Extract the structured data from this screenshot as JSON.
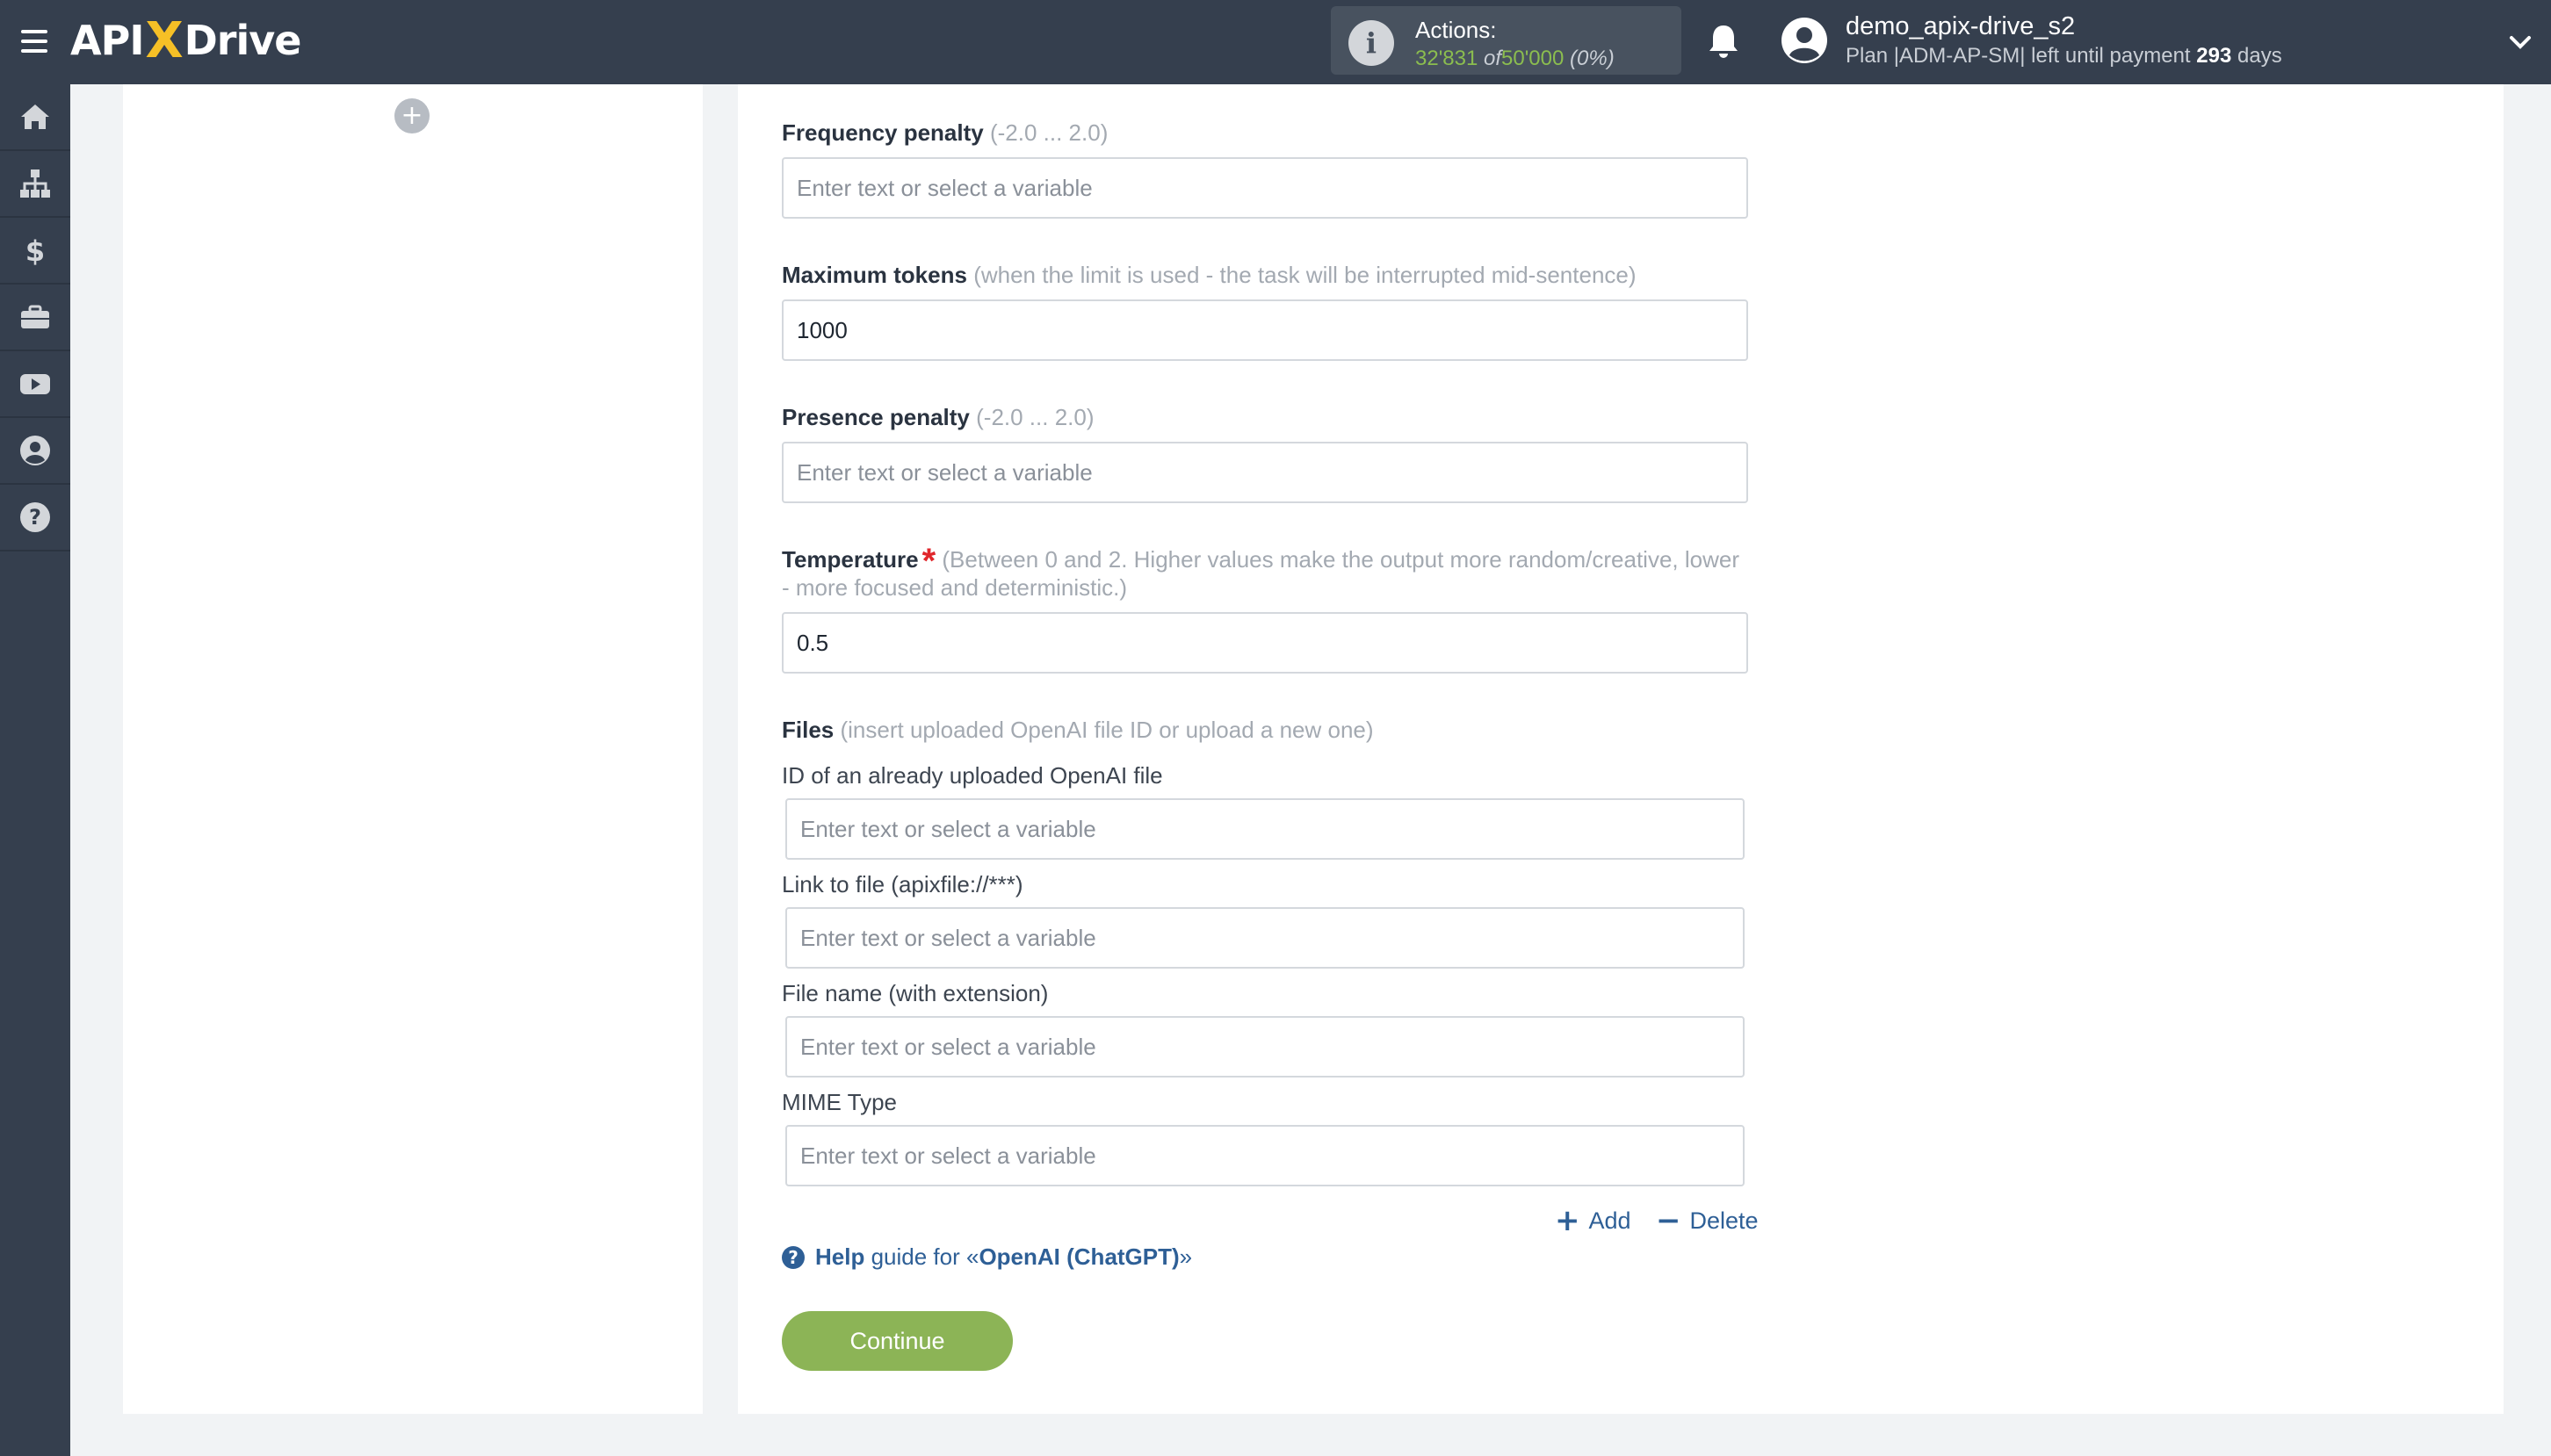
{
  "app": {
    "logo_left": "API",
    "logo_x": "X",
    "logo_right": "Drive"
  },
  "topbar": {
    "actions_label": "Actions:",
    "actions_used": "32'831",
    "actions_of": "of",
    "actions_total": "50'000",
    "actions_percent": "(0%)",
    "user_name": "demo_apix-drive_s2",
    "plan_prefix": "Plan |ADM-AP-SM| left until payment",
    "plan_days": "293",
    "plan_suffix": "days",
    "icons": [
      "menu-icon",
      "info-icon",
      "bell-icon",
      "user-avatar-icon",
      "chevron-down-icon"
    ]
  },
  "sidebar": {
    "items": [
      {
        "icon": "home-icon"
      },
      {
        "icon": "sitemap-icon"
      },
      {
        "icon": "dollar-icon"
      },
      {
        "icon": "briefcase-icon"
      },
      {
        "icon": "youtube-icon"
      },
      {
        "icon": "user-circle-icon"
      },
      {
        "icon": "question-circle-icon"
      }
    ]
  },
  "left_panel": {
    "add_symbol": "+"
  },
  "form": {
    "frequency_penalty": {
      "label": "Frequency penalty",
      "hint": "(-2.0 ... 2.0)",
      "value": "",
      "placeholder": "Enter text or select a variable"
    },
    "max_tokens": {
      "label": "Maximum tokens",
      "hint": "(when the limit is used - the task will be interrupted mid-sentence)",
      "value": "1000",
      "placeholder": "Enter text or select a variable"
    },
    "presence_penalty": {
      "label": "Presence penalty",
      "hint": "(-2.0 ... 2.0)",
      "value": "",
      "placeholder": "Enter text or select a variable"
    },
    "temperature": {
      "label": "Temperature",
      "required_mark": "*",
      "hint": "(Between 0 and 2. Higher values make the output more random/creative, lower - more focused and deterministic.)",
      "value": "0.5",
      "placeholder": "Enter text or select a variable"
    },
    "files": {
      "label": "Files",
      "hint": "(insert uploaded OpenAI file ID or upload a new one)",
      "file_id_label": "ID of an already uploaded OpenAI file",
      "file_id_placeholder": "Enter text or select a variable",
      "link_label": "Link to file (apixfile://***)",
      "link_placeholder": "Enter text or select a variable",
      "name_label": "File name (with extension)",
      "name_placeholder": "Enter text or select a variable",
      "mime_label": "MIME Type",
      "mime_placeholder": "Enter text or select a variable",
      "add_symbol": "+",
      "add_label": "Add",
      "delete_symbol": "−",
      "delete_label": "Delete"
    },
    "help": {
      "icon": "?",
      "word": "Help",
      "text": "guide for «",
      "service": "OpenAI (ChatGPT)",
      "close": "»"
    },
    "continue_label": "Continue"
  },
  "colors": {
    "topbar_bg": "#353f4e",
    "page_bg": "#f1f3f5",
    "accent_green": "#8cb456",
    "link_blue": "#2e5f96",
    "required_red": "#e0262b",
    "logo_yellow": "#f6c026"
  }
}
